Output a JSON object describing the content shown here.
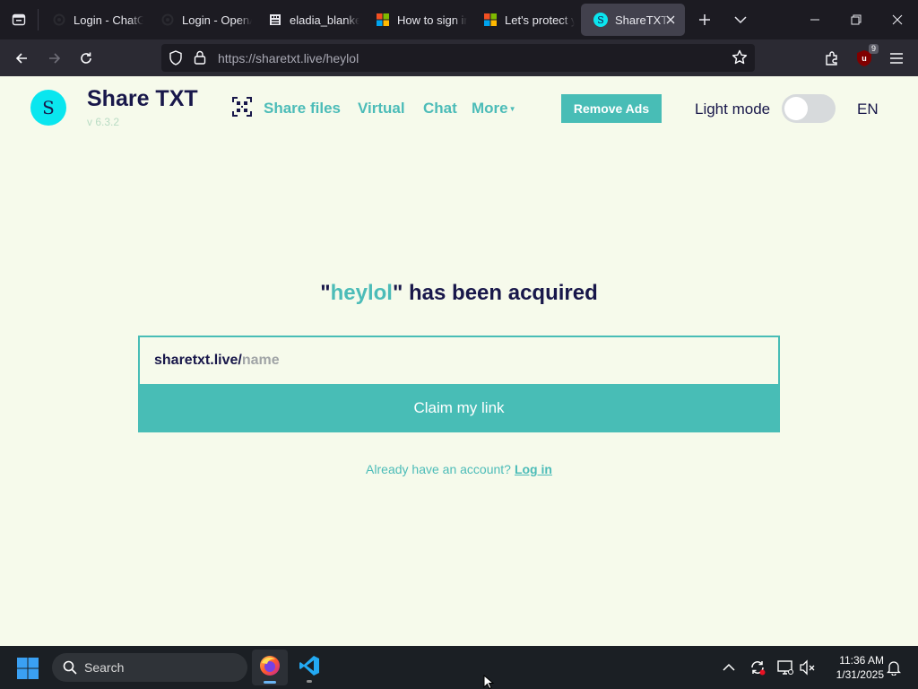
{
  "browser": {
    "tabs": [
      {
        "title": "Login - ChatGPT",
        "favicon": "chatgpt-icon",
        "active": false
      },
      {
        "title": "Login - OpenAI",
        "favicon": "openai-icon",
        "active": false
      },
      {
        "title": "eladia_blankenship",
        "favicon": "document-icon",
        "active": false
      },
      {
        "title": "How to sign in",
        "favicon": "microsoft-icon",
        "active": false
      },
      {
        "title": "Let's protect your",
        "favicon": "microsoft-icon",
        "active": false
      },
      {
        "title": "ShareTXT - ",
        "favicon": "sharetxt-icon",
        "active": true
      }
    ],
    "url_host": "https://sharetxt.live/",
    "url_path": "heylol",
    "ublock_count": "9"
  },
  "site": {
    "logo_letter": "S",
    "title": "Share TXT",
    "version": "v 6.3.2",
    "nav": [
      {
        "label": "Share files"
      },
      {
        "label": "Virtual"
      },
      {
        "label": "Chat"
      },
      {
        "label": "More"
      }
    ],
    "remove_ads": "Remove Ads",
    "light_mode": "Light mode",
    "light_mode_on": false,
    "language": "EN"
  },
  "main": {
    "heading_quote_open": "\"",
    "heading_name": "heylol",
    "heading_rest": "\" has been acquired",
    "input_prefix": "sharetxt.live/",
    "input_placeholder": "name",
    "input_value": "",
    "claim_button": "Claim my link",
    "account_text": "Already have an account?",
    "login_link": "Log in"
  },
  "taskbar": {
    "search_label": "Search",
    "time": "11:36 AM",
    "date": "1/31/2025"
  },
  "colors": {
    "accent": "#48bdb6",
    "logo": "#0ae6ef",
    "dark_text": "#18174a",
    "page_bg": "#f6faeb"
  }
}
